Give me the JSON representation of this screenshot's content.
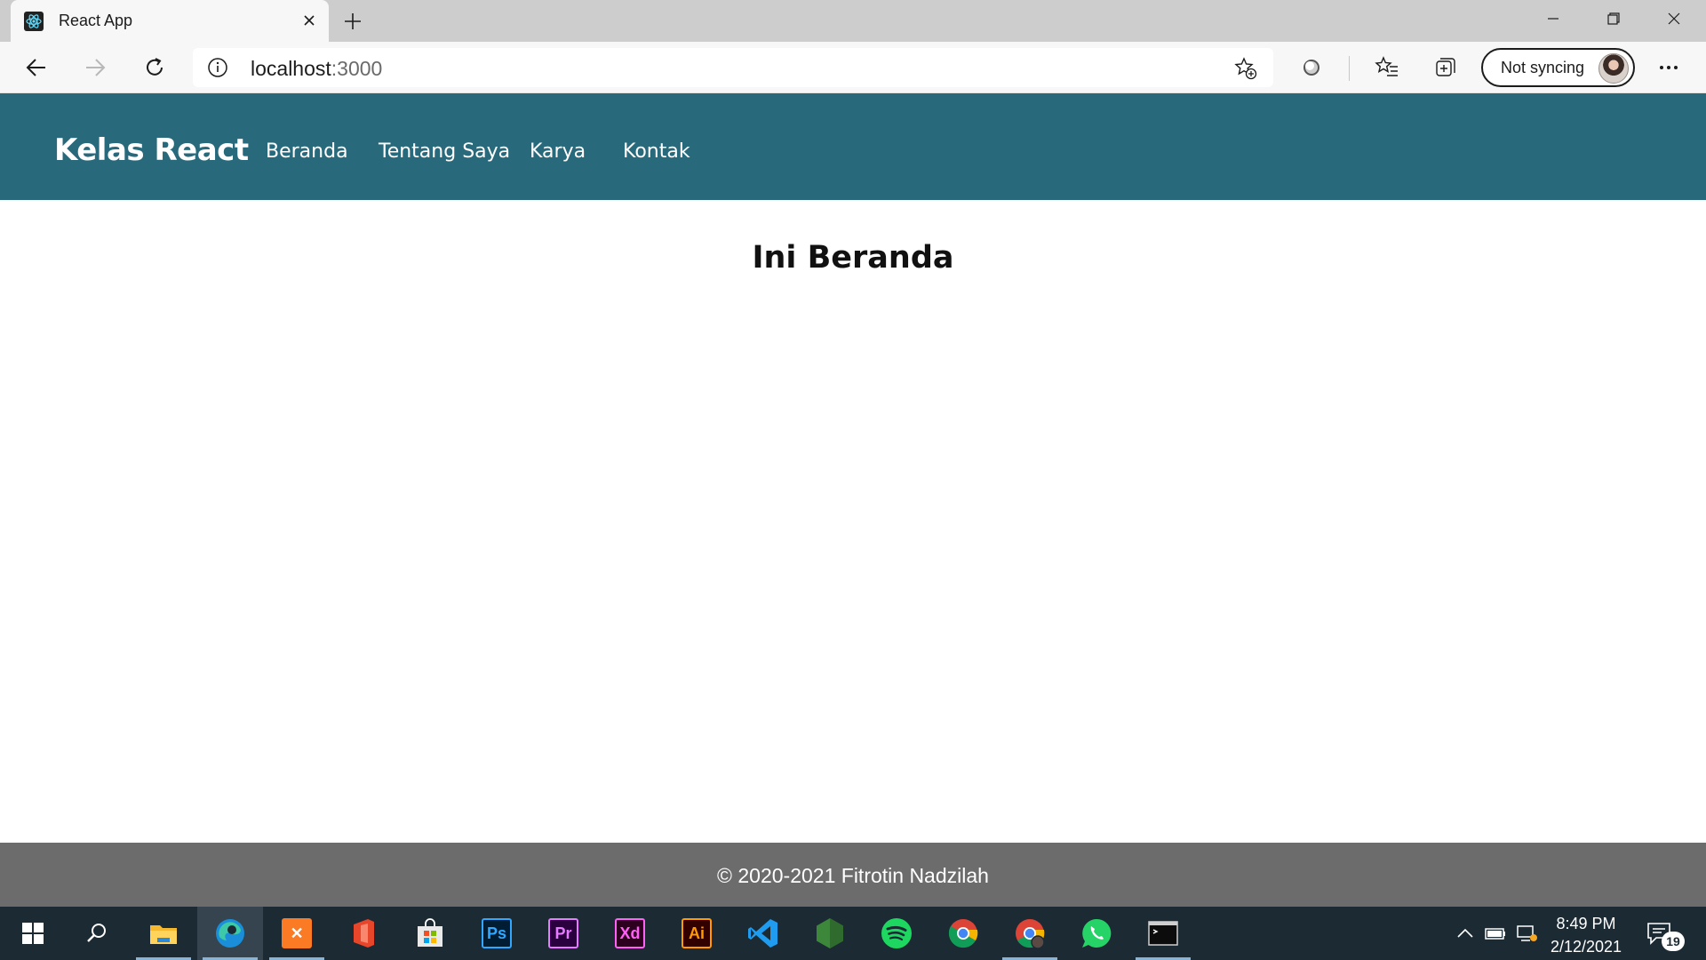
{
  "browser": {
    "tab": {
      "title": "React App",
      "favicon": "react-logo-icon",
      "close_icon": "close-icon"
    },
    "new_tab_icon": "plus-icon",
    "window_controls": [
      "minimize-icon",
      "restore-icon",
      "close-icon"
    ],
    "toolbar": {
      "back_icon": "back-arrow-icon",
      "forward_icon": "forward-arrow-icon",
      "refresh_icon": "refresh-icon",
      "address": {
        "info_icon": "site-info-icon",
        "host": "localhost",
        "port": ":3000",
        "favorite_icon": "add-favorite-icon"
      },
      "extension_icon": "extension-icon",
      "favorites_icon": "favorites-icon",
      "collections_icon": "collections-icon",
      "profile": {
        "label": "Not syncing",
        "avatar": "profile-avatar"
      },
      "menu_icon": "more-menu-icon"
    }
  },
  "page": {
    "navbar": {
      "brand": "Kelas React",
      "links": [
        "Beranda",
        "Tentang Saya",
        "Karya",
        "Kontak"
      ]
    },
    "heading": "Ini Beranda",
    "footer": "© 2020-2021 Fitrotin Nadzilah",
    "colors": {
      "navbar": "#286a7b",
      "footer": "#6c6c6c"
    }
  },
  "taskbar": {
    "apps": [
      {
        "name": "start-icon",
        "label": ""
      },
      {
        "name": "search-icon",
        "label": ""
      },
      {
        "name": "file-explorer-icon",
        "label": ""
      },
      {
        "name": "edge-icon",
        "label": ""
      },
      {
        "name": "xampp-icon",
        "label": ""
      },
      {
        "name": "office-icon",
        "label": ""
      },
      {
        "name": "store-icon",
        "label": ""
      },
      {
        "name": "photoshop-icon",
        "label": "Ps"
      },
      {
        "name": "premiere-icon",
        "label": "Pr"
      },
      {
        "name": "xd-icon",
        "label": "Xd"
      },
      {
        "name": "illustrator-icon",
        "label": "Ai"
      },
      {
        "name": "vscode-icon",
        "label": ""
      },
      {
        "name": "nodejs-icon",
        "label": ""
      },
      {
        "name": "spotify-icon",
        "label": ""
      },
      {
        "name": "chrome-icon",
        "label": ""
      },
      {
        "name": "chrome-profile-icon",
        "label": ""
      },
      {
        "name": "whatsapp-icon",
        "label": ""
      },
      {
        "name": "terminal-icon",
        "label": ""
      }
    ],
    "tray": {
      "time": "8:49 PM",
      "date": "2/12/2021",
      "notification_count": "19"
    }
  }
}
